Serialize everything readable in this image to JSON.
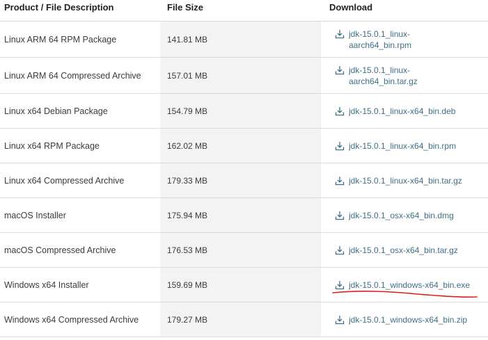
{
  "headers": {
    "product": "Product / File Description",
    "size": "File Size",
    "download": "Download"
  },
  "rows": [
    {
      "product": "Linux ARM 64 RPM Package",
      "size": "141.81 MB",
      "file_line1": "jdk-15.0.1_linux-",
      "file_line2": "aarch64_bin.rpm"
    },
    {
      "product": "Linux ARM 64 Compressed Archive",
      "size": "157.01 MB",
      "file_line1": "jdk-15.0.1_linux-",
      "file_line2": "aarch64_bin.tar.gz"
    },
    {
      "product": "Linux x64 Debian Package",
      "size": "154.79 MB",
      "file_line1": "jdk-15.0.1_linux-x64_bin.deb",
      "file_line2": ""
    },
    {
      "product": "Linux x64 RPM Package",
      "size": "162.02 MB",
      "file_line1": "jdk-15.0.1_linux-x64_bin.rpm",
      "file_line2": ""
    },
    {
      "product": "Linux x64 Compressed Archive",
      "size": "179.33 MB",
      "file_line1": "jdk-15.0.1_linux-x64_bin.tar.gz",
      "file_line2": ""
    },
    {
      "product": "macOS Installer",
      "size": "175.94 MB",
      "file_line1": "jdk-15.0.1_osx-x64_bin.dmg",
      "file_line2": ""
    },
    {
      "product": "macOS Compressed Archive",
      "size": "176.53 MB",
      "file_line1": "jdk-15.0.1_osx-x64_bin.tar.gz",
      "file_line2": ""
    },
    {
      "product": "Windows x64 Installer",
      "size": "159.69 MB",
      "file_line1": "jdk-15.0.1_windows-x64_bin.exe",
      "file_line2": ""
    },
    {
      "product": "Windows x64 Compressed Archive",
      "size": "179.27 MB",
      "file_line1": "jdk-15.0.1_windows-x64_bin.zip",
      "file_line2": ""
    }
  ],
  "icons": {
    "download": "download-icon"
  },
  "colors": {
    "link": "#3e6f86",
    "size_column_bg": "#f3f3f3",
    "annotation": "#e0201c"
  }
}
